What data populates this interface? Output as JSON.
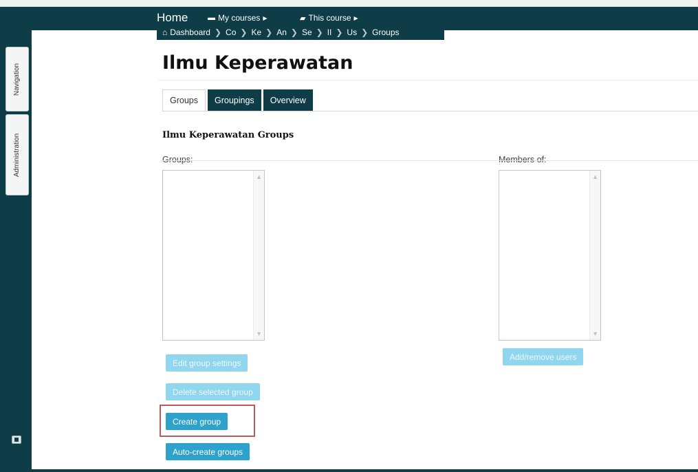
{
  "navbar": {
    "brand": "Home",
    "menus": [
      {
        "label": "My courses",
        "icon": "folder-icon"
      },
      {
        "label": "This course",
        "icon": "book-icon"
      }
    ]
  },
  "breadcrumb": [
    {
      "label": "Dashboard",
      "icon": "home-icon"
    },
    {
      "label": "Co"
    },
    {
      "label": "Ke"
    },
    {
      "label": "An"
    },
    {
      "label": "Se"
    },
    {
      "label": "II"
    },
    {
      "label": "Us"
    },
    {
      "label": "Groups"
    }
  ],
  "sidebar": {
    "tabs": [
      "Navigation",
      "Administration"
    ],
    "dock_icon": "dock-icon"
  },
  "page": {
    "title": "Ilmu Keperawatan",
    "tabs": [
      {
        "label": "Groups",
        "active": true
      },
      {
        "label": "Groupings",
        "active": false
      },
      {
        "label": "Overview",
        "active": false
      }
    ],
    "heading": "Ilmu Keperawatan Groups",
    "groups_label": "Groups:",
    "members_label": "Members of:",
    "groups_options": [],
    "members_options": []
  },
  "buttons": {
    "edit_group_settings": "Edit group settings",
    "delete_selected_group": "Delete selected group",
    "create_group": "Create group",
    "auto_create_groups": "Auto-create groups",
    "add_remove_users": "Add/remove users"
  },
  "colors": {
    "navbar": "#0e3c47",
    "button_enabled": "#2fa2cc",
    "button_disabled": "#8fd6ee",
    "highlight": "#b85a5c"
  }
}
